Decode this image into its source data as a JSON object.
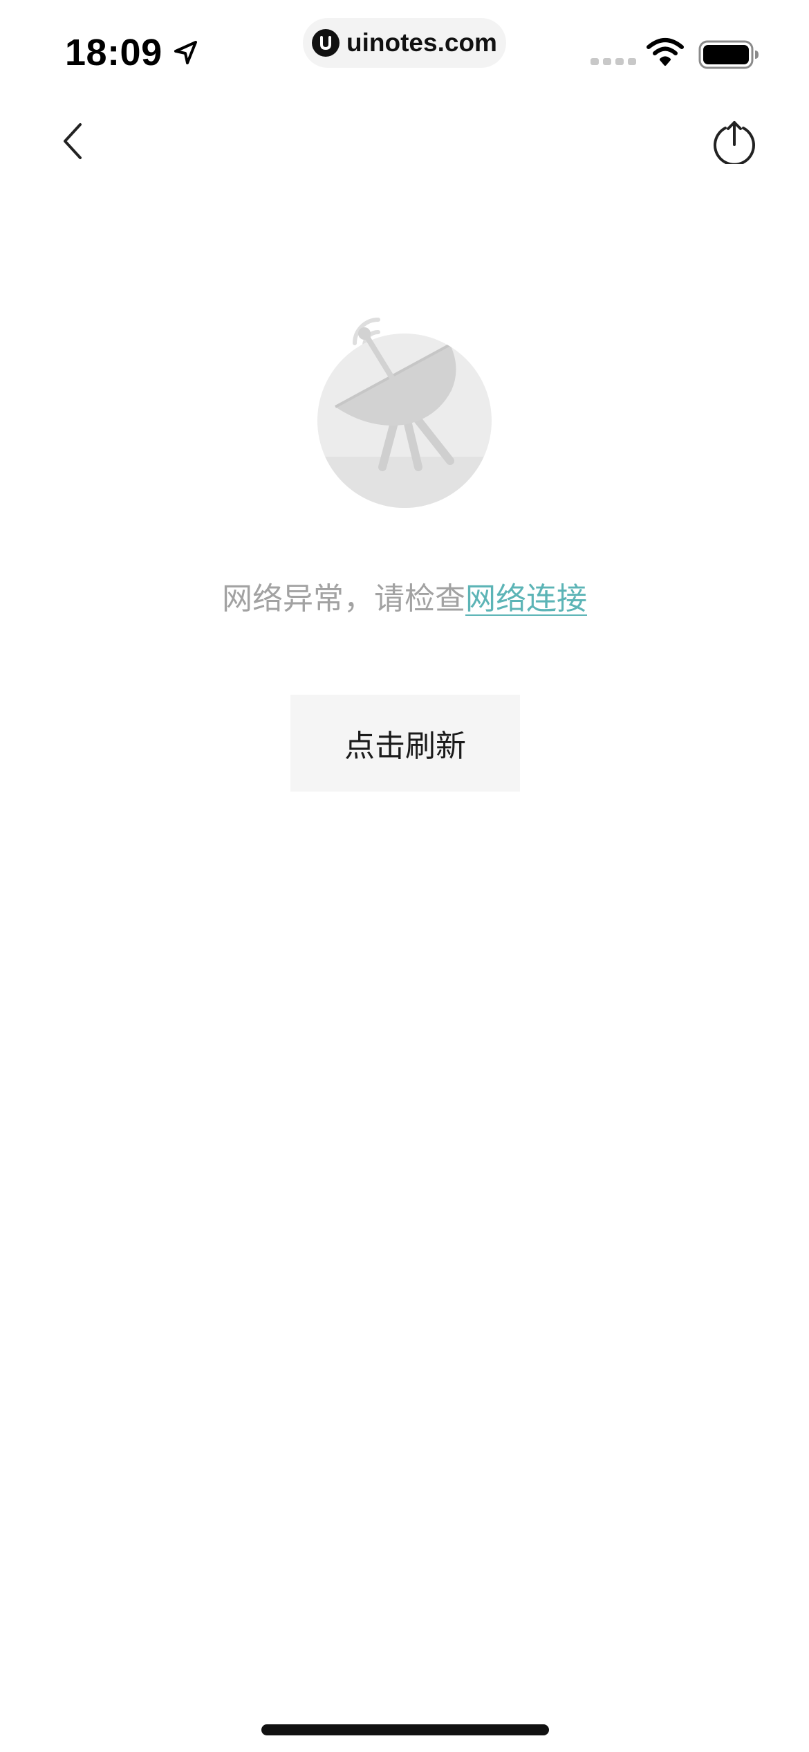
{
  "status_bar": {
    "time": "18:09",
    "url": "uinotes.com",
    "icons": [
      "location-arrow-icon",
      "signal-icon",
      "wifi-icon",
      "battery-icon"
    ]
  },
  "nav": {
    "back_icon": "chevron-left-icon",
    "share_icon": "share-upload-icon"
  },
  "error_state": {
    "illustration": "satellite-dish-icon",
    "message_prefix": "网络异常，请检查",
    "message_link": "网络连接",
    "refresh_label": "点击刷新"
  },
  "colors": {
    "link": "#5cb4b6",
    "message_text": "#a2a2a2",
    "button_bg": "#f5f5f5",
    "illustration_gray": "#e6e6e6"
  }
}
